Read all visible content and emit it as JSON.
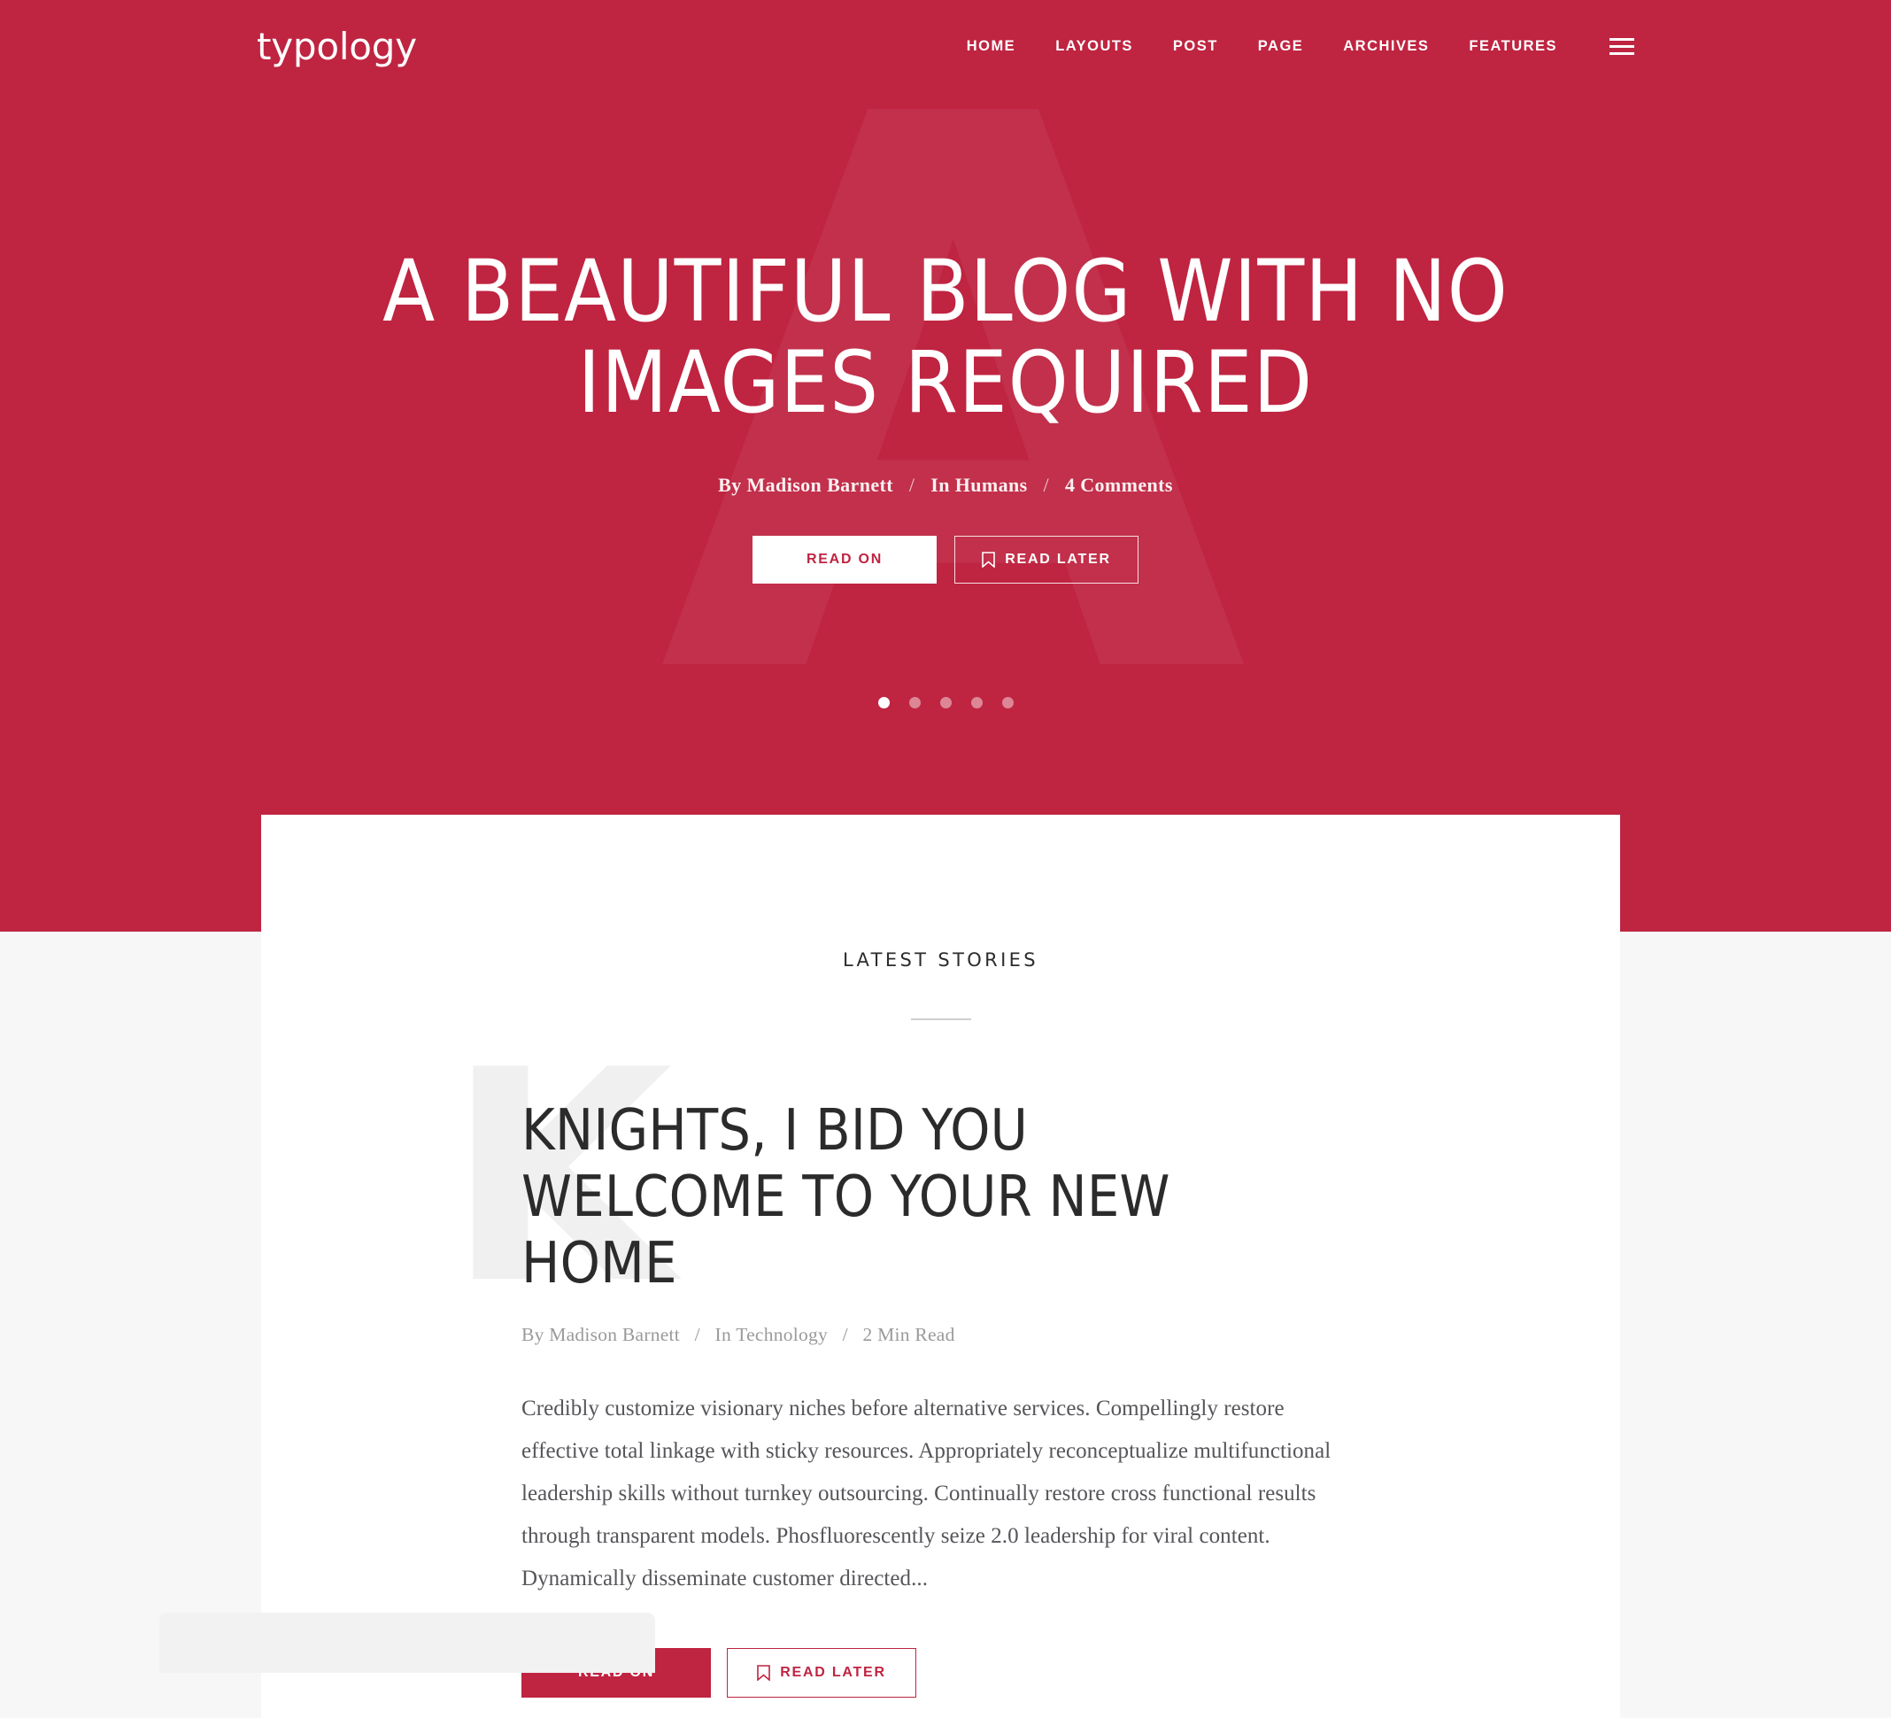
{
  "brand": {
    "logo": "typology",
    "accent_color": "#bf2441",
    "hero_bg": "#bf2441",
    "page_bg": "#f7f7f7",
    "watermark_letter": "A"
  },
  "nav": {
    "items": [
      {
        "label": "HOME"
      },
      {
        "label": "LAYOUTS"
      },
      {
        "label": "POST"
      },
      {
        "label": "PAGE"
      },
      {
        "label": "ARCHIVES"
      },
      {
        "label": "FEATURES"
      }
    ],
    "menu_icon": "hamburger-icon"
  },
  "hero": {
    "title": "A Beautiful Blog With No Images Required",
    "meta": {
      "author": "By Madison Barnett",
      "sep1": "/",
      "category": "In Humans",
      "sep2": "/",
      "comments": "4 Comments"
    },
    "buttons": {
      "primary": "Read On",
      "secondary": "Read Later",
      "secondary_icon": "bookmark-icon"
    },
    "carousel": {
      "total_slides": 5,
      "active_slide": 1
    }
  },
  "section": {
    "title": "Latest Stories"
  },
  "article": {
    "watermark_letter": "K",
    "title": "Knights, I Bid You Welcome To Your New Home",
    "meta": {
      "author": "By Madison Barnett",
      "sep1": "/",
      "category": "In Technology",
      "sep2": "/",
      "read_time": "2 Min Read"
    },
    "excerpt": "Credibly customize visionary niches before alternative services. Compellingly restore effective total linkage with sticky resources. Appropriately reconceptualize multifunctional leadership skills without turnkey outsourcing. Continually restore cross functional results through transparent models. Phosfluorescently seize 2.0 leadership for viral content. Dynamically disseminate customer directed...",
    "buttons": {
      "primary": "Read On",
      "secondary": "Read Later",
      "secondary_icon": "bookmark-icon"
    }
  }
}
